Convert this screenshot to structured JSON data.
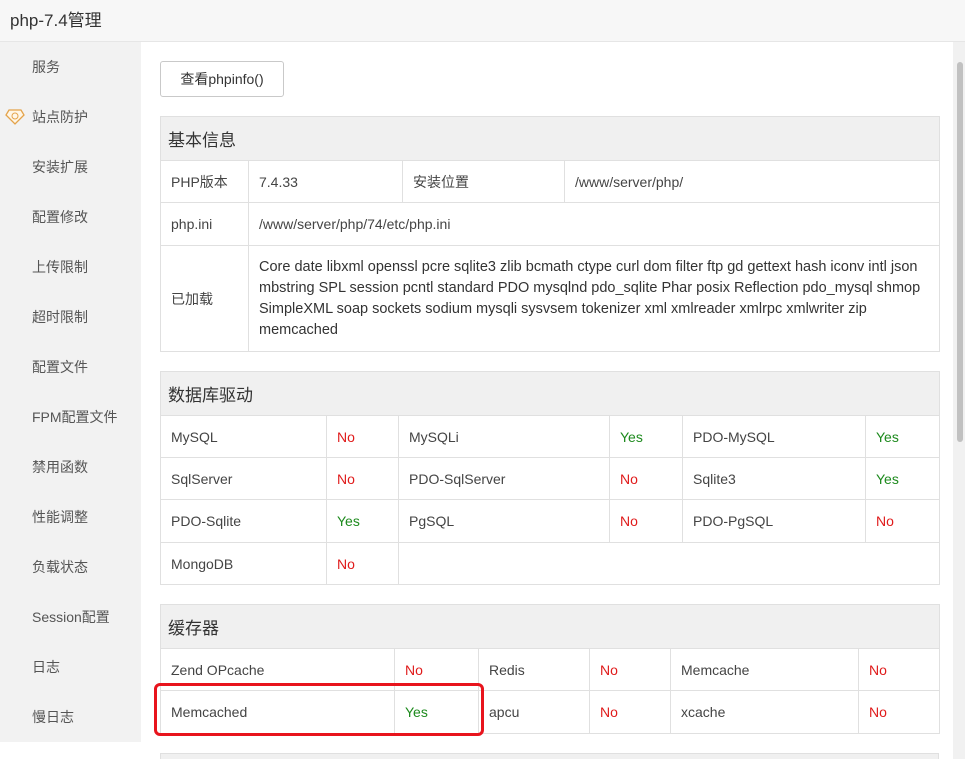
{
  "window": {
    "title": "php-7.4管理"
  },
  "sidebar": {
    "items": [
      {
        "label": "服务"
      },
      {
        "label": "站点防护"
      },
      {
        "label": "安装扩展"
      },
      {
        "label": "配置修改"
      },
      {
        "label": "上传限制"
      },
      {
        "label": "超时限制"
      },
      {
        "label": "配置文件"
      },
      {
        "label": "FPM配置文件"
      },
      {
        "label": "禁用函数"
      },
      {
        "label": "性能调整"
      },
      {
        "label": "负载状态"
      },
      {
        "label": "Session配置"
      },
      {
        "label": "日志"
      },
      {
        "label": "慢日志"
      }
    ]
  },
  "phpinfo_button": "查看phpinfo()",
  "basic": {
    "header": "基本信息",
    "version_label": "PHP版本",
    "version_value": "7.4.33",
    "path_label": "安装位置",
    "path_value": "/www/server/php/",
    "ini_label": "php.ini",
    "ini_value": "/www/server/php/74/etc/php.ini",
    "loaded_label": "已加载",
    "loaded_value": "Core date libxml openssl pcre sqlite3 zlib bcmath ctype curl dom filter ftp gd gettext hash iconv intl json mbstring SPL session pcntl standard PDO mysqlnd pdo_sqlite Phar posix Reflection pdo_mysql shmop SimpleXML soap sockets sodium mysqli sysvsem tokenizer xml xmlreader xmlrpc xmlwriter zip memcached"
  },
  "db": {
    "header": "数据库驱动",
    "rows": [
      [
        {
          "name": "MySQL",
          "status": "No"
        },
        {
          "name": "MySQLi",
          "status": "Yes"
        },
        {
          "name": "PDO-MySQL",
          "status": "Yes"
        }
      ],
      [
        {
          "name": "SqlServer",
          "status": "No"
        },
        {
          "name": "PDO-SqlServer",
          "status": "No"
        },
        {
          "name": "Sqlite3",
          "status": "Yes"
        }
      ],
      [
        {
          "name": "PDO-Sqlite",
          "status": "Yes"
        },
        {
          "name": "PgSQL",
          "status": "No"
        },
        {
          "name": "PDO-PgSQL",
          "status": "No"
        }
      ],
      [
        {
          "name": "MongoDB",
          "status": "No"
        }
      ]
    ]
  },
  "cache": {
    "header": "缓存器",
    "rows": [
      [
        {
          "name": "Zend OPcache",
          "status": "No"
        },
        {
          "name": "Redis",
          "status": "No"
        },
        {
          "name": "Memcache",
          "status": "No"
        }
      ],
      [
        {
          "name": "Memcached",
          "status": "Yes"
        },
        {
          "name": "apcu",
          "status": "No"
        },
        {
          "name": "xcache",
          "status": "No"
        }
      ]
    ]
  },
  "colors": {
    "yes": "#1d8a1d",
    "no": "#e01b1b",
    "highlight": "#e8141d"
  }
}
